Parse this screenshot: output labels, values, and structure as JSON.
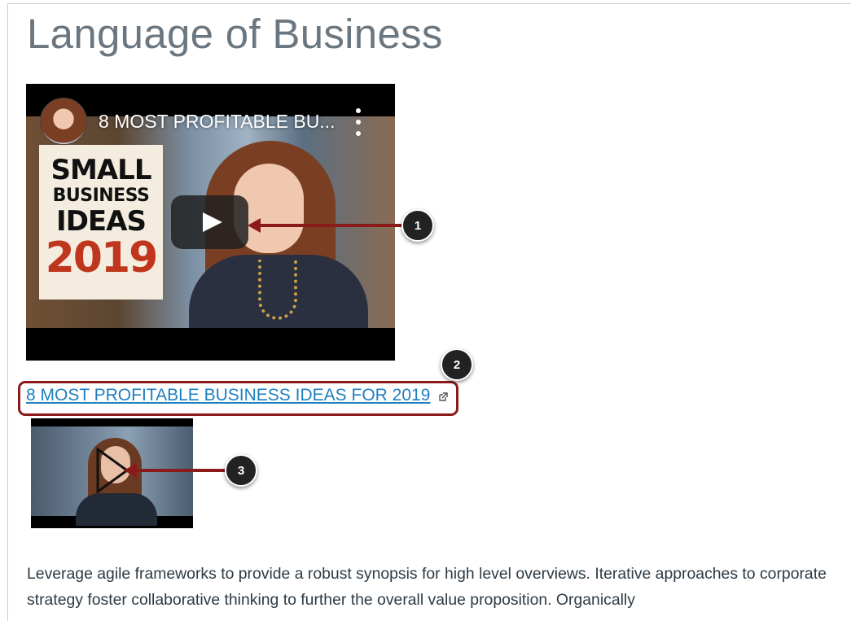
{
  "page": {
    "title": "Language of Business"
  },
  "embedded_video": {
    "title": "8 MOST PROFITABLE BU...",
    "thumbnail_text": {
      "line1": "SMALL",
      "line2": "BUSINESS",
      "line3": "IDEAS",
      "line4": "2019"
    },
    "icons": {
      "avatar": "channel-avatar",
      "menu": "kebab-menu-icon",
      "play": "play-icon"
    }
  },
  "video_link": {
    "label": "8 MOST PROFITABLE BUSINESS IDEAS FOR 2019",
    "icon": "external-link-icon"
  },
  "callouts": {
    "one": "1",
    "two": "2",
    "three": "3"
  },
  "body": {
    "text": "Leverage agile frameworks to provide a robust synopsis for high level overviews. Iterative approaches to corporate strategy foster collaborative thinking to further the overall value proposition. Organically"
  },
  "colors": {
    "link": "#1f7fc0",
    "callout": "#8b1a1a",
    "title": "#6b7780",
    "thumbnail_year": "#c0361c"
  }
}
